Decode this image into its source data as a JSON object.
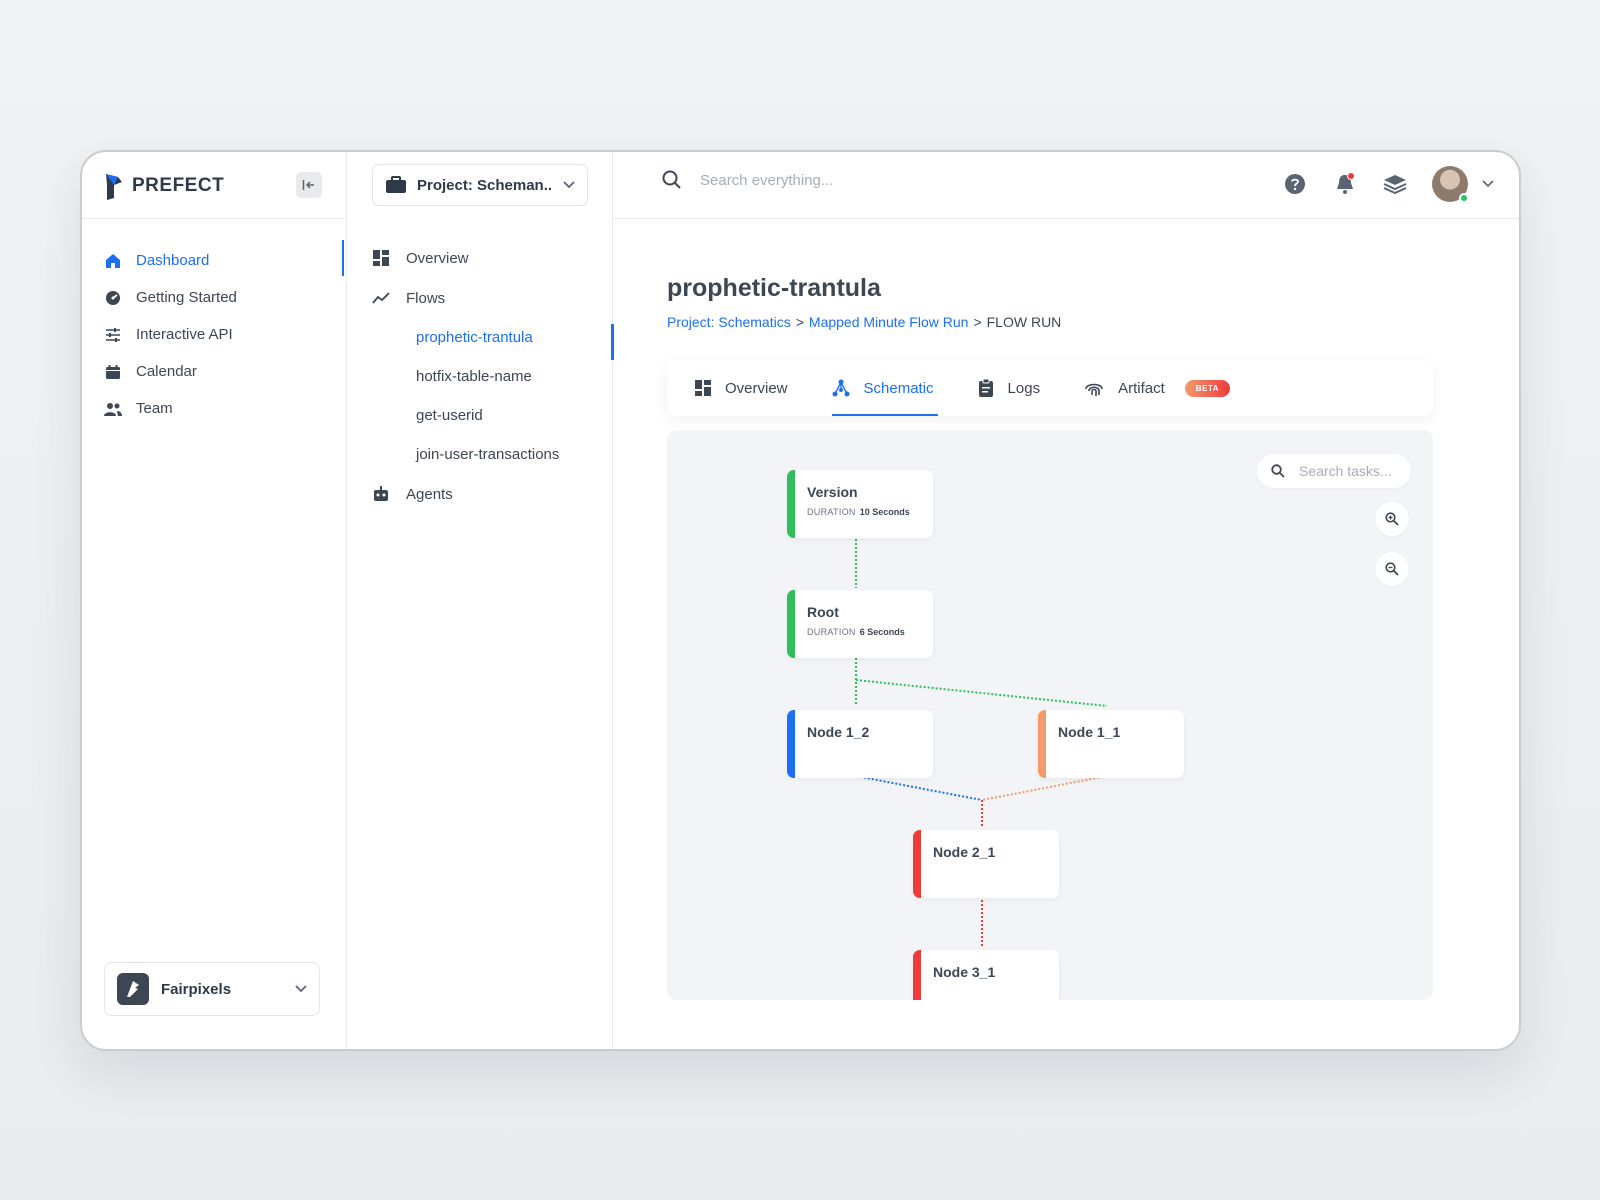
{
  "app": {
    "logo_text": "PREFECT"
  },
  "sidebar": {
    "items": [
      {
        "label": "Dashboard",
        "icon": "home-icon",
        "active": true
      },
      {
        "label": "Getting Started",
        "icon": "gauge-icon"
      },
      {
        "label": "Interactive API",
        "icon": "sliders-icon"
      },
      {
        "label": "Calendar",
        "icon": "calendar-icon"
      },
      {
        "label": "Team",
        "icon": "team-icon"
      }
    ],
    "org": {
      "name": "Fairpixels"
    }
  },
  "project": {
    "selector_label": "Project: Scheman...",
    "nav": {
      "overview": "Overview",
      "flows": "Flows",
      "flow_items": [
        "prophetic-trantula",
        "hotfix-table-name",
        "get-userid",
        "join-user-transactions"
      ],
      "agents": "Agents"
    }
  },
  "header": {
    "search_placeholder": "Search everything..."
  },
  "main": {
    "title": "prophetic-trantula",
    "breadcrumb": {
      "project": "Project: Schematics",
      "sep1": ">",
      "flow": "Mapped Minute Flow Run",
      "sep2": ">",
      "current": "FLOW RUN"
    },
    "tabs": {
      "overview": "Overview",
      "schematic": "Schematic",
      "logs": "Logs",
      "artifact": "Artifact",
      "beta": "BETA"
    },
    "task_search_placeholder": "Search tasks...",
    "nodes": {
      "version": {
        "name": "Version",
        "duration_label": "DURATION",
        "duration": "10 Seconds"
      },
      "root": {
        "name": "Root",
        "duration_label": "DURATION",
        "duration": "6 Seconds"
      },
      "node12": {
        "name": "Node 1_2"
      },
      "node11": {
        "name": "Node 1_1"
      },
      "node21": {
        "name": "Node 2_1"
      },
      "node31": {
        "name": "Node 3_1"
      }
    }
  },
  "colors": {
    "accent": "#1d6ff2",
    "green": "#2fbf5b",
    "blue": "#1d6ff2",
    "orange": "#f39b6e",
    "red": "#ef3b3b"
  }
}
